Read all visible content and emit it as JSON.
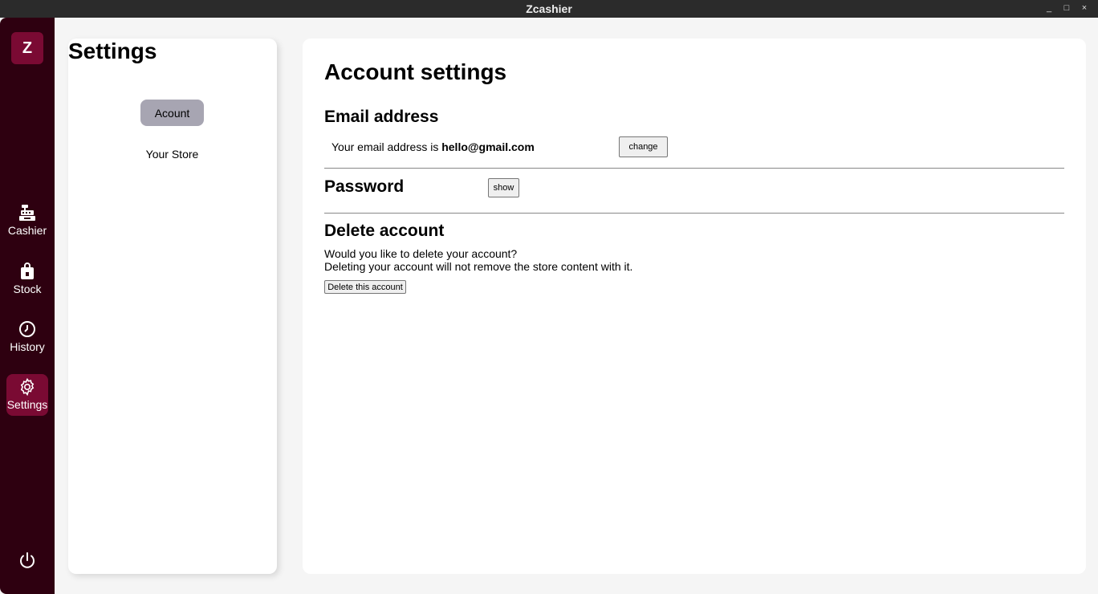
{
  "window": {
    "title": "Zcashier",
    "minimize": "_",
    "maximize": "□",
    "close": "×"
  },
  "rail": {
    "logo": "Z",
    "items": [
      {
        "label": "Cashier",
        "icon": "cash-register-icon"
      },
      {
        "label": "Stock",
        "icon": "store-bag-icon"
      },
      {
        "label": "History",
        "icon": "clock-icon"
      },
      {
        "label": "Settings",
        "icon": "gear-icon",
        "active": true
      }
    ],
    "power_icon": "power-icon"
  },
  "settings_nav": {
    "title": "Settings",
    "tabs": [
      {
        "label": "Acount",
        "active": true
      },
      {
        "label": "Your Store",
        "active": false
      }
    ]
  },
  "account": {
    "title": "Account settings",
    "email": {
      "heading": "Email address",
      "prefix": "Your email address is ",
      "value": "hello@gmail.com",
      "button": "change"
    },
    "password": {
      "heading": "Password",
      "button": "show"
    },
    "delete": {
      "heading": "Delete account",
      "question": "Would you like to delete your account?",
      "note": "Deleting your account will not remove the store content with it.",
      "button": "Delete this account"
    }
  },
  "colors": {
    "rail": "#2e0010",
    "accent": "#7a0a33",
    "tab_active": "#a7a5b2"
  }
}
